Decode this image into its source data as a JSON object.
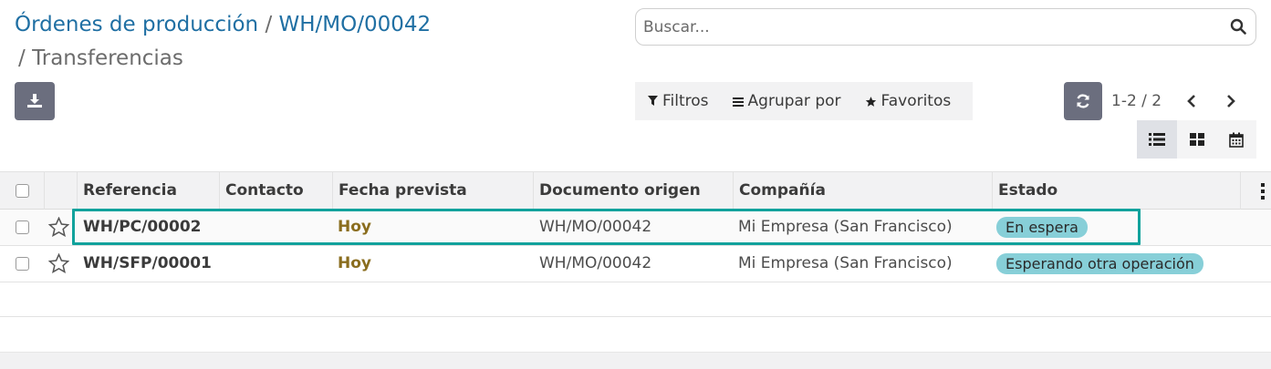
{
  "breadcrumb": {
    "parent_label": "Órdenes de producción",
    "separator": "/",
    "record_label": "WH/MO/00042",
    "current_label": "Transferencias"
  },
  "search": {
    "placeholder": "Buscar..."
  },
  "filters": {
    "filter_label": "Filtros",
    "groupby_label": "Agrupar por",
    "favorites_label": "Favoritos"
  },
  "pager": {
    "value": "1-2 / 2"
  },
  "table": {
    "columns": [
      "Referencia",
      "Contacto",
      "Fecha prevista",
      "Documento origen",
      "Compañía",
      "Estado"
    ],
    "rows": [
      {
        "reference": "WH/PC/00002",
        "contact": "",
        "scheduled": "Hoy",
        "origin": "WH/MO/00042",
        "company": "Mi Empresa (San Francisco)",
        "state": "En espera"
      },
      {
        "reference": "WH/SFP/00001",
        "contact": "",
        "scheduled": "Hoy",
        "origin": "WH/MO/00042",
        "company": "Mi Empresa (San Francisco)",
        "state": "Esperando otra operación"
      }
    ]
  },
  "colors": {
    "accent": "#1f6fa3",
    "button": "#6b6e7e",
    "highlight": "#11a29c",
    "badge": "#87cfd8",
    "date": "#8a6d1e"
  },
  "icons": [
    "download-icon",
    "search-icon",
    "filter-icon",
    "group-by-icon",
    "favorites-star-icon",
    "refresh-icon",
    "chevron-left-icon",
    "chevron-right-icon",
    "list-view-icon",
    "kanban-view-icon",
    "calendar-view-icon",
    "star-icon",
    "column-options-icon"
  ]
}
